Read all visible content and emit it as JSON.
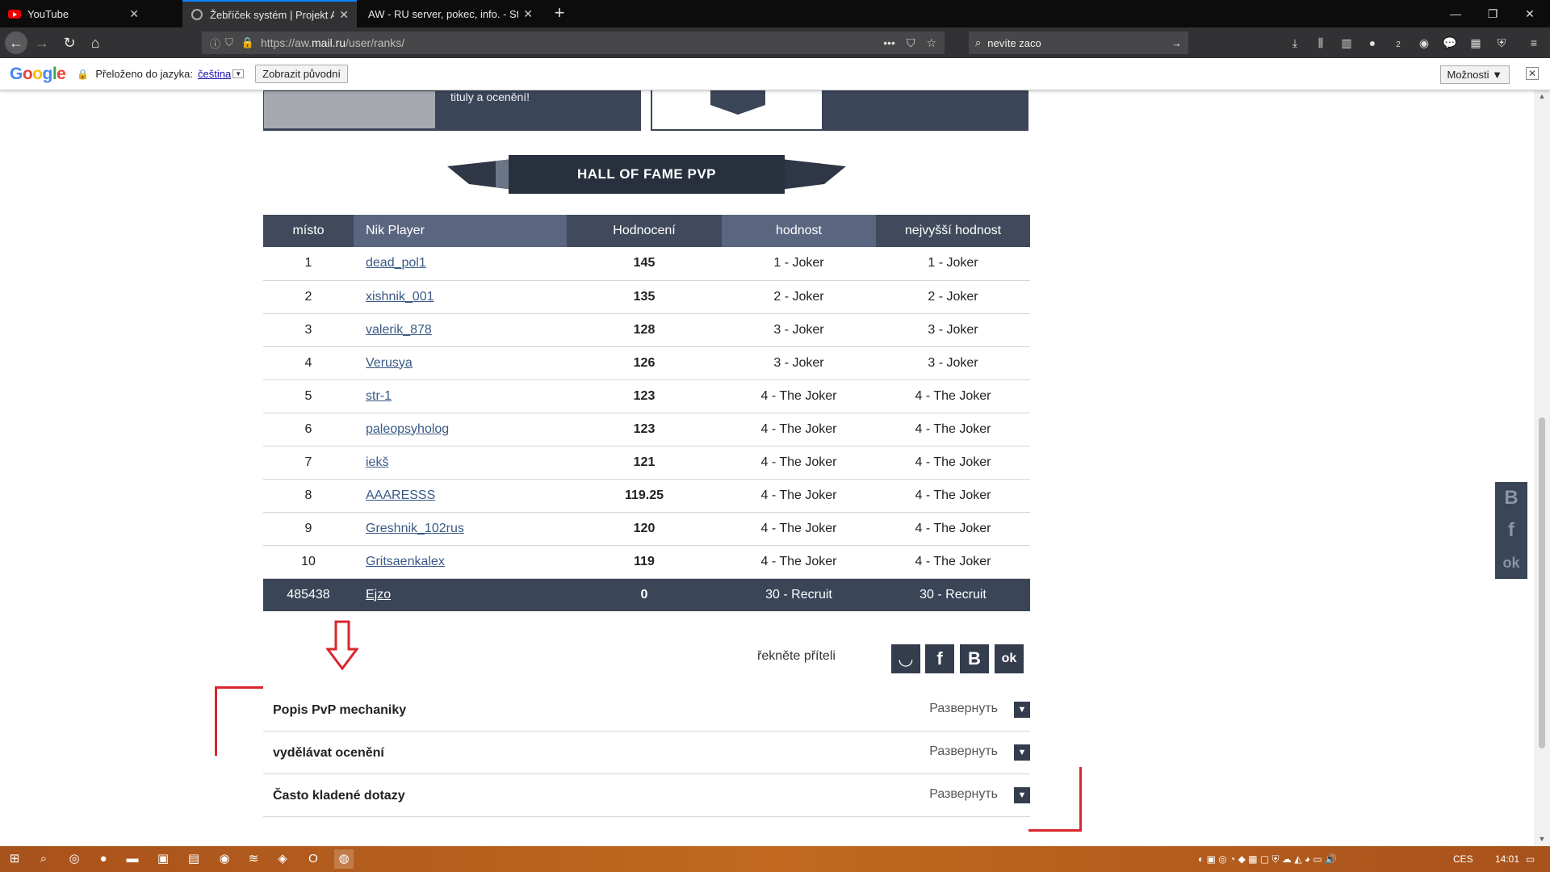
{
  "browser": {
    "tabs": [
      {
        "title": "YouTube",
        "active": false
      },
      {
        "title": "Žebříček systém | Projekt Arma",
        "active": true
      },
      {
        "title": "AW - RU server, pokec, info. - Strán",
        "active": false
      }
    ],
    "url_prefix": "https://aw.",
    "url_host": "mail.ru",
    "url_path": "/user/ranks/",
    "search_value": "nevíte zaco",
    "extension_badge": "2"
  },
  "translate": {
    "logo": "Google",
    "translated_to_label": "Přeloženo do jazyka:",
    "language": "čeština",
    "show_original": "Zobrazit původní",
    "options": "Možnosti ▼",
    "close": "✕"
  },
  "banner": {
    "left_text": "tituly a ocenění!"
  },
  "hall_of_fame": {
    "title": "HALL OF FAME PVP"
  },
  "ranks_table": {
    "headers": [
      "místo",
      "Nik Player",
      "Hodnocení",
      "hodnost",
      "nejvyšší hodnost"
    ],
    "rows": [
      {
        "place": "1",
        "nick": "dead_pol1",
        "score": "145",
        "rank": "1 - Joker",
        "max_rank": "1 - Joker"
      },
      {
        "place": "2",
        "nick": "xishnik_001",
        "score": "135",
        "rank": "2 - Joker",
        "max_rank": "2 - Joker"
      },
      {
        "place": "3",
        "nick": "valerik_878",
        "score": "128",
        "rank": "3 - Joker",
        "max_rank": "3 - Joker"
      },
      {
        "place": "4",
        "nick": "Verusya",
        "score": "126",
        "rank": "3 - Joker",
        "max_rank": "3 - Joker"
      },
      {
        "place": "5",
        "nick": "str-1",
        "score": "123",
        "rank": "4 - The Joker",
        "max_rank": "4 - The Joker"
      },
      {
        "place": "6",
        "nick": "paleopsyholog",
        "score": "123",
        "rank": "4 - The Joker",
        "max_rank": "4 - The Joker"
      },
      {
        "place": "7",
        "nick": "iekš",
        "score": "121",
        "rank": "4 - The Joker",
        "max_rank": "4 - The Joker"
      },
      {
        "place": "8",
        "nick": "AAARESSS",
        "score": "119.25",
        "rank": "4 - The Joker",
        "max_rank": "4 - The Joker"
      },
      {
        "place": "9",
        "nick": "Greshnik_102rus",
        "score": "120",
        "rank": "4 - The Joker",
        "max_rank": "4 - The Joker"
      },
      {
        "place": "10",
        "nick": "Gritsaenkalex",
        "score": "119",
        "rank": "4 - The Joker",
        "max_rank": "4 - The Joker"
      }
    ],
    "current_user": {
      "place": "485438",
      "nick": "Ejzo",
      "score": "0",
      "rank": "30 - Recruit",
      "max_rank": "30 - Recruit"
    }
  },
  "share": {
    "label": "řekněte příteli",
    "buttons": [
      {
        "icon": "smile-icon",
        "glyph": "◡"
      },
      {
        "icon": "facebook-icon",
        "glyph": "f"
      },
      {
        "icon": "vk-icon",
        "glyph": "B"
      },
      {
        "icon": "odnoklassniki-icon",
        "glyph": "ok"
      }
    ]
  },
  "accordion": [
    {
      "title": "Popis PvP mechaniky",
      "expand": "Развернуть"
    },
    {
      "title": "vydělávat ocenění",
      "expand": "Развернуть"
    },
    {
      "title": "Často kladené dotazy",
      "expand": "Развернуть"
    }
  ],
  "side_share": [
    "B",
    "f",
    "ok"
  ],
  "taskbar": {
    "language": "CES",
    "time": "14:01"
  },
  "colors": {
    "header_dark": "#404a5c",
    "header_light": "#5a6680",
    "accent_red": "#d9262e",
    "link": "#3a5a86"
  }
}
